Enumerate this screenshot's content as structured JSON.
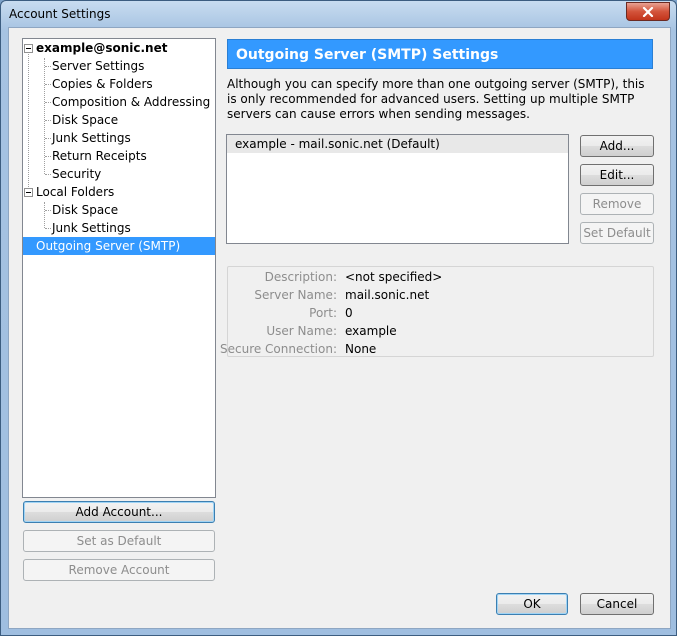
{
  "window": {
    "title": "Account Settings"
  },
  "tree": {
    "account": "example@sonic.net",
    "account_items": [
      "Server Settings",
      "Copies & Folders",
      "Composition & Addressing",
      "Disk Space",
      "Junk Settings",
      "Return Receipts",
      "Security"
    ],
    "local_folders": "Local Folders",
    "local_items": [
      "Disk Space",
      "Junk Settings"
    ],
    "outgoing": "Outgoing Server (SMTP)"
  },
  "left_buttons": {
    "add_account": "Add Account...",
    "set_default": "Set as Default",
    "remove_account": "Remove Account"
  },
  "panel": {
    "heading": "Outgoing Server (SMTP) Settings",
    "description": "Although you can specify more than one outgoing server (SMTP), this is only recommended for advanced users. Setting up multiple SMTP servers can cause errors when sending messages."
  },
  "servers": [
    "example - mail.sonic.net (Default)"
  ],
  "server_buttons": {
    "add": "Add...",
    "edit": "Edit...",
    "remove": "Remove",
    "set_default": "Set Default"
  },
  "details": {
    "description_label": "Description:",
    "description_value": "<not specified>",
    "server_label": "Server Name:",
    "server_value": "mail.sonic.net",
    "port_label": "Port:",
    "port_value": "0",
    "user_label": "User Name:",
    "user_value": "example",
    "secure_label": "Secure Connection:",
    "secure_value": "None"
  },
  "dialog_buttons": {
    "ok": "OK",
    "cancel": "Cancel"
  }
}
